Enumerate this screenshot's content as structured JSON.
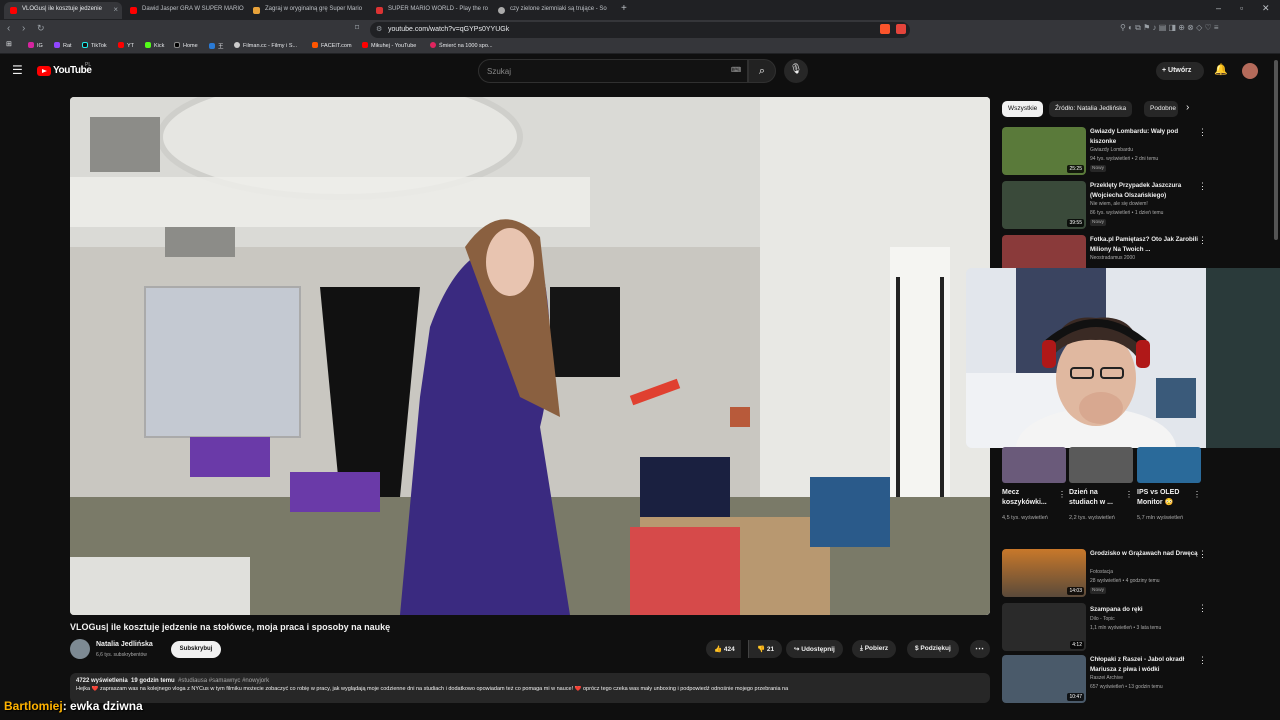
{
  "browser": {
    "tabs": [
      {
        "label": "VLOGus| ile kosztuje jedzenie",
        "active": true
      },
      {
        "label": "Dawid Jasper GRA W SUPER MARIO"
      },
      {
        "label": "Zagraj w oryginalną grę Super Mario"
      },
      {
        "label": "SUPER MARIO WORLD - Play the ro"
      },
      {
        "label": "czy zielone ziemniaki są trujące - So"
      }
    ],
    "new_tab": "+",
    "url": "youtube.com/watch?v=qGYPs0YYUGk",
    "bookmarks": [
      "IG",
      "Rat",
      "TikTok",
      "YT",
      "Kick",
      "Home",
      "王",
      "Filman.cc - Filmy i S...",
      "FACEIT.com",
      "Mikuhej - YouTube",
      "Śmierć na 1000 spo..."
    ]
  },
  "youtube": {
    "logo": "YouTube",
    "country": "PL",
    "search_placeholder": "Szukaj",
    "create_label": "Utwórz"
  },
  "video": {
    "title": "VLOGus| ile kosztuje jedzenie na stołówce, moja praca i sposoby na naukę",
    "channel": "Natalia Jedlińska",
    "subscribers": "6,6 tys. subskrybentów",
    "subscribe_label": "Subskrybuj",
    "likes": "424",
    "dislikes": "21",
    "share_label": "Udostępnij",
    "download_label": "Pobierz",
    "thanks_label": "Podziękuj",
    "views": "4722 wyświetlenia",
    "age": "19 godzin temu",
    "hashtags": "#studiausa #samawnyc #nowyjork",
    "description": "Hejka ❤️ zapraszam was na kolejnego vloga z NYCus  w tym filmiku możecie zobaczyć co robię w pracy, jak wyglądają moje codzienne dni na studiach i dodatkowo opowiadam też co pomaga mi w nauce! ❤️ oprócz tego czeka was mały unboxing i podpowiedź odnośnie mojego przebrania na"
  },
  "sidebar": {
    "chips": [
      "Wszystkie",
      "Źródło: Natalia Jedlińska",
      "Podobne"
    ],
    "videos": [
      {
        "title": "Gwiazdy Lombardu: Wały pod kiszonke",
        "channel": "Gwiazdy Lombardu",
        "meta": "94 tys. wyświetleń • 2 dni temu",
        "badge": "Nowy",
        "duration": "25:25",
        "color": "#5a7a3a"
      },
      {
        "title": "Przeklęty Przypadek Jaszczura (Wojciecha Olszańskiego)",
        "channel": "Nie wiem, ale się dowiem!",
        "meta": "86 tys. wyświetleń • 1 dzień temu",
        "badge": "Nowy",
        "duration": "39:55",
        "color": "#3a4a3a"
      },
      {
        "title": "Fotka.pl Pamiętasz? Oto Jak Zarobili Miliony Na Twoich ...",
        "channel": "Neostradamus 2000",
        "meta": "",
        "badge": "",
        "duration": "",
        "color": "#8a3a3a"
      }
    ],
    "shorts": [
      {
        "title": "Mecz koszykówki...",
        "meta": "4,5 tys. wyświetleń",
        "color": "#6a5a7a"
      },
      {
        "title": "Dzień na studiach w ...",
        "meta": "2,2 tys. wyświetleń",
        "color": "#5a5a5a"
      },
      {
        "title": "IPS vs OLED Monitor 😳",
        "meta": "5,7 mln wyświetleń",
        "color": "#2a6a9a"
      }
    ],
    "videos2": [
      {
        "title": "Grodzisko w Grążawach nad Drwęcą",
        "channel": "Fotostacja",
        "meta": "28 wyświetleń • 4 godziny temu",
        "badge": "Nowy",
        "duration": "14:03",
        "color": "#c8782a"
      },
      {
        "title": "Szampana do ręki",
        "channel": "Dilo - Topic",
        "meta": "1,1 mln wyświetleń • 3 lata temu",
        "badge": "",
        "duration": "4:12",
        "color": "#2a2a2a"
      },
      {
        "title": "Chłopaki z Raszei - Jabol okradł Mariusza z piwa i wódki",
        "channel": "Raszei Archive",
        "meta": "657 wyświetleń • 13 godzin temu",
        "badge": "",
        "duration": "10:47",
        "color": "#4a5a6a"
      }
    ]
  },
  "chat": {
    "user": "Bartlomiej",
    "message": ": ewka dziwna"
  }
}
